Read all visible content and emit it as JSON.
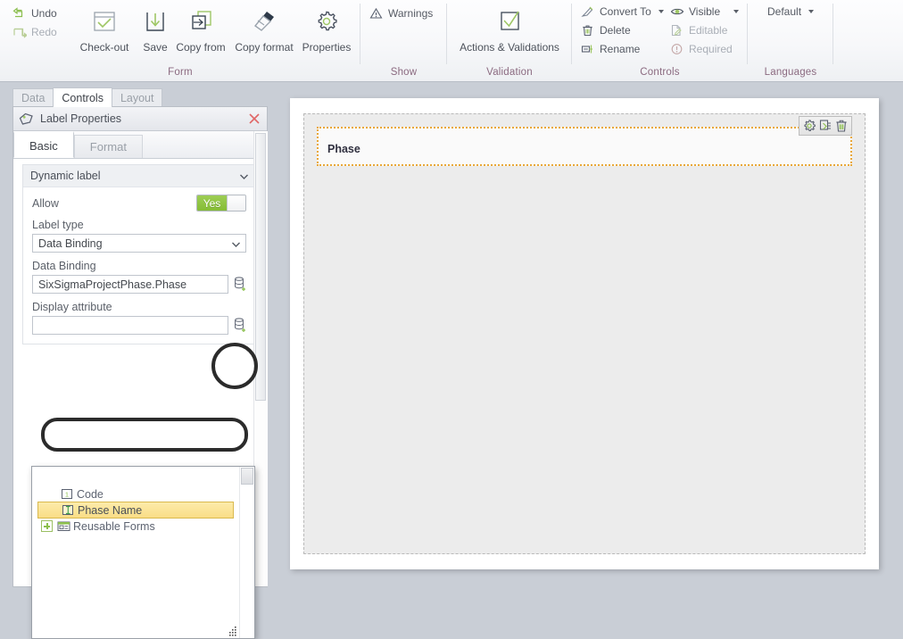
{
  "ribbon": {
    "groups": [
      {
        "label": "Form"
      },
      {
        "label": "Show"
      },
      {
        "label": "Validation"
      },
      {
        "label": "Controls"
      },
      {
        "label": "Languages"
      }
    ],
    "form": {
      "undo": "Undo",
      "redo": "Redo",
      "checkout": "Check-out",
      "save": "Save",
      "copy_from": "Copy from",
      "copy_format": "Copy format",
      "properties": "Properties"
    },
    "show": {
      "warnings": "Warnings"
    },
    "validation": {
      "actions_validations": "Actions & Validations"
    },
    "controls": {
      "convert_to": "Convert To",
      "delete": "Delete",
      "rename": "Rename",
      "visible": "Visible",
      "editable": "Editable",
      "required": "Required"
    },
    "languages": {
      "default": "Default"
    }
  },
  "left_panel": {
    "tabs": [
      {
        "label": "Data",
        "active": false
      },
      {
        "label": "Controls",
        "active": true
      },
      {
        "label": "Layout",
        "active": false
      }
    ],
    "title": "Label Properties",
    "subtabs": [
      {
        "label": "Basic",
        "active": true
      },
      {
        "label": "Format",
        "active": false
      }
    ],
    "section": {
      "title": "Dynamic label",
      "allow_label": "Allow",
      "allow_value": "Yes",
      "label_type_label": "Label type",
      "label_type_value": "Data Binding",
      "data_binding_label": "Data Binding",
      "data_binding_value": "SixSigmaProjectPhase.Phase",
      "display_attribute_label": "Display attribute",
      "display_attribute_value": ""
    },
    "dropdown": {
      "items": [
        {
          "label": "Code",
          "icon": "number-attribute-icon",
          "selected": false,
          "expandable": false
        },
        {
          "label": "Phase Name",
          "icon": "text-attribute-icon",
          "selected": true,
          "expandable": false
        },
        {
          "label": "Reusable Forms",
          "icon": "reusable-forms-icon",
          "selected": false,
          "expandable": true
        }
      ]
    }
  },
  "canvas": {
    "widget_label": "Phase",
    "tools": [
      "gear-icon",
      "duplicate-icon",
      "trash-icon"
    ]
  },
  "colors": {
    "accent_green": "#8CC63F",
    "group_label": "#8b6a80",
    "selection_orange": "#E9A83A",
    "selected_row_bg": "#F9DD86",
    "annotation": "#2B2B2B"
  }
}
